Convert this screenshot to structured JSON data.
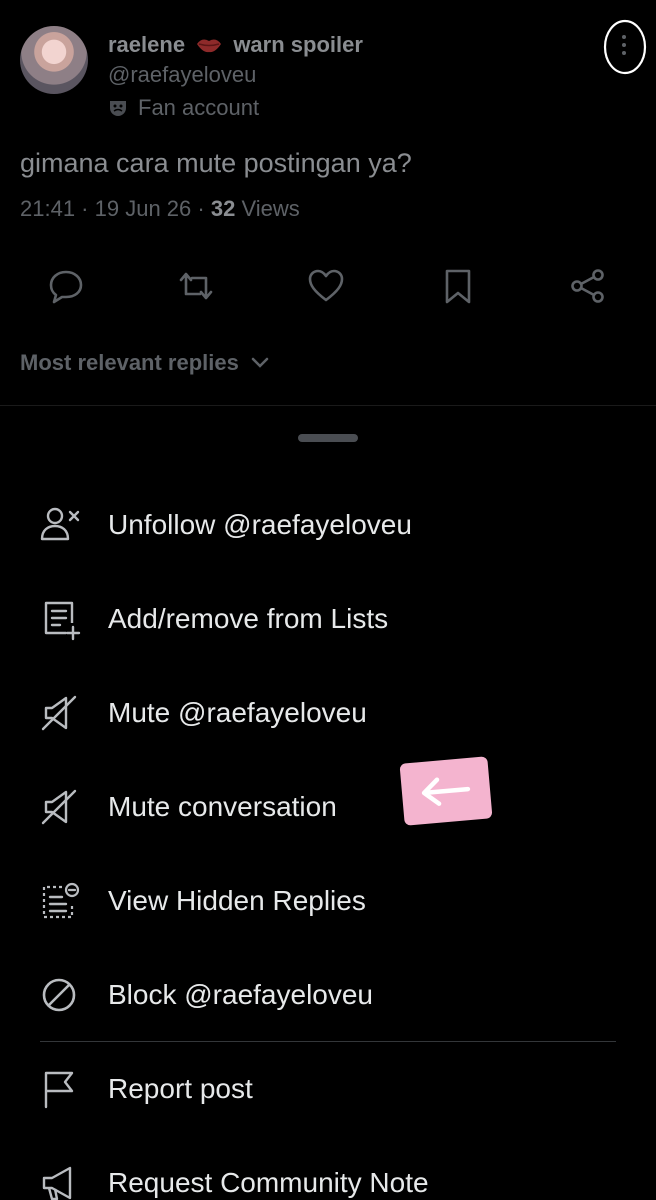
{
  "post": {
    "display_name_1": "raelene",
    "display_name_2": "warn spoiler",
    "handle": "@raefayeloveu",
    "account_label": "Fan account",
    "text": "gimana cara mute postingan ya?",
    "time": "21:41",
    "date": "19 Jun 26",
    "views_count": "32",
    "views_label": "Views",
    "icons": [
      "reply-icon",
      "retweet-icon",
      "like-icon",
      "bookmark-icon",
      "share-icon",
      "more-icon",
      "theater-mask-icon",
      "lips-emoji"
    ]
  },
  "replies_filter": {
    "label": "Most relevant replies"
  },
  "menu": {
    "items": [
      {
        "label": "Unfollow @raefayeloveu",
        "icon": "unfollow-icon"
      },
      {
        "label": "Add/remove from Lists",
        "icon": "list-add-icon"
      },
      {
        "label": "Mute @raefayeloveu",
        "icon": "mute-icon"
      },
      {
        "label": "Mute conversation",
        "icon": "mute-icon"
      },
      {
        "label": "View Hidden Replies",
        "icon": "hidden-replies-icon"
      },
      {
        "label": "Block @raefayeloveu",
        "icon": "block-icon"
      },
      {
        "label": "Report post",
        "icon": "flag-icon"
      },
      {
        "label": "Request Community Note",
        "icon": "megaphone-icon"
      }
    ]
  },
  "colors": {
    "background": "#000000",
    "text": "#e7e9ea",
    "dim_text": "#5e6267",
    "sticker": "#f4b4cf"
  }
}
